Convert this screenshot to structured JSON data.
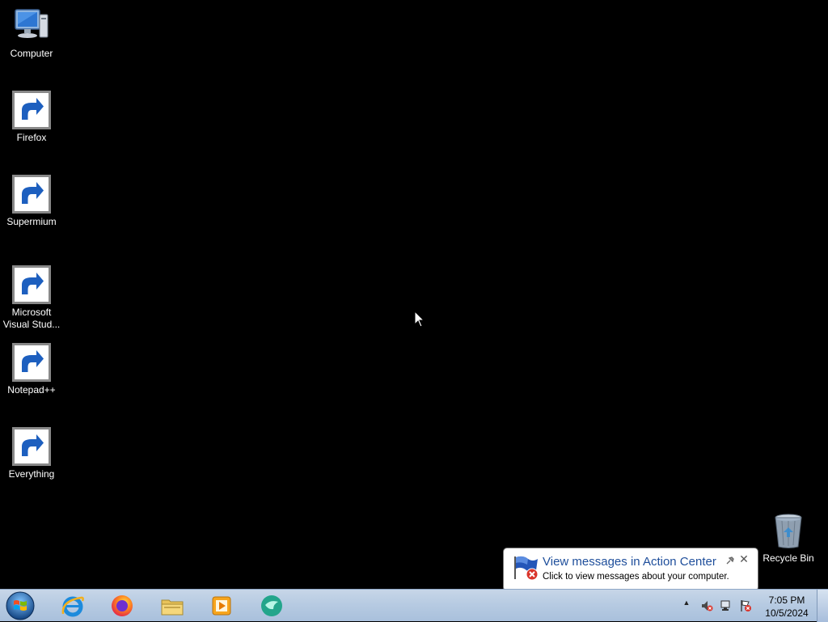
{
  "desktop_icons": [
    {
      "label": "Computer",
      "icon": "computer-icon",
      "shortcut": false
    },
    {
      "label": "Firefox",
      "icon": "firefox-icon",
      "shortcut": true
    },
    {
      "label": "Supermium",
      "icon": "supermium-icon",
      "shortcut": true
    },
    {
      "label": "Microsoft Visual Stud...",
      "icon": "visual-studio-icon",
      "shortcut": true
    },
    {
      "label": "Notepad++",
      "icon": "notepadpp-icon",
      "shortcut": true
    },
    {
      "label": "Everything",
      "icon": "everything-icon",
      "shortcut": true
    }
  ],
  "recycle_bin": {
    "label": "Recycle Bin",
    "icon": "recycle-bin-icon"
  },
  "notification": {
    "title": "View messages in Action Center",
    "body": "Click to view messages about your computer.",
    "close_glyph": "✕"
  },
  "taskbar": {
    "start": "start-button",
    "pinned": [
      "internet-explorer-icon",
      "firefox-icon",
      "file-explorer-icon",
      "media-player-icon",
      "supermium-icon"
    ],
    "tray": {
      "show_hidden": "▲"
    },
    "clock": {
      "time": "7:05 PM",
      "date": "10/5/2024"
    }
  },
  "colors": {
    "desktop_bg": "#000000",
    "taskbar_bg": "#b7cbe2",
    "balloon_title": "#1e4e9b"
  }
}
